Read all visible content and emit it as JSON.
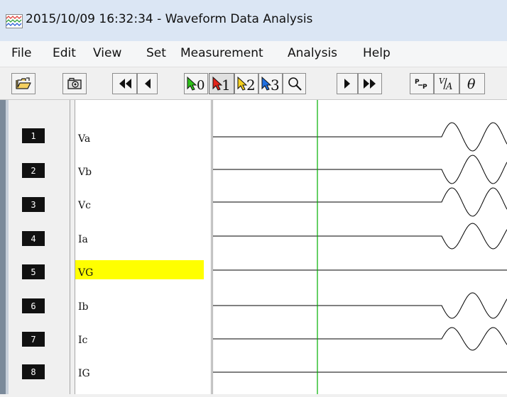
{
  "window": {
    "title": "2015/10/09 16:32:34  - Waveform Data Analysis"
  },
  "menu": [
    {
      "id": "file",
      "label": "File"
    },
    {
      "id": "edit",
      "label": "Edit"
    },
    {
      "id": "view",
      "label": "View"
    },
    {
      "id": "set",
      "label": "Set"
    },
    {
      "id": "measurement",
      "label": "Measurement"
    },
    {
      "id": "analysis",
      "label": "Analysis"
    },
    {
      "id": "help",
      "label": "Help"
    }
  ],
  "toolbar": {
    "cursor0_label": "0",
    "cursor1_label": "1",
    "cursor2_label": "2",
    "cursor3_label": "3",
    "vpp_label": "P-P",
    "va_label": "V/A",
    "theta_label": "θ",
    "icons": [
      "open-folder-icon",
      "camera-icon",
      "rewind-fast-icon",
      "step-back-icon",
      "cursor-0-icon",
      "cursor-1-icon",
      "cursor-2-icon",
      "cursor-3-icon",
      "zoom-icon",
      "step-forward-icon",
      "forward-fast-icon",
      "peak-to-peak-icon",
      "voltage-ampere-icon",
      "phase-angle-icon"
    ],
    "selected_cursor": "1"
  },
  "channels": [
    {
      "number": "1",
      "name": "Va",
      "highlighted": false
    },
    {
      "number": "2",
      "name": "Vb",
      "highlighted": false
    },
    {
      "number": "3",
      "name": "Vc",
      "highlighted": false
    },
    {
      "number": "4",
      "name": "Ia",
      "highlighted": false
    },
    {
      "number": "5",
      "name": "VG",
      "highlighted": true
    },
    {
      "number": "6",
      "name": "Ib",
      "highlighted": false
    },
    {
      "number": "7",
      "name": "Ic",
      "highlighted": false
    },
    {
      "number": "8",
      "name": "IG",
      "highlighted": false
    }
  ],
  "colors": {
    "highlight": "#ffff00",
    "cursor_line": "#00b000",
    "trace": "#000000"
  }
}
